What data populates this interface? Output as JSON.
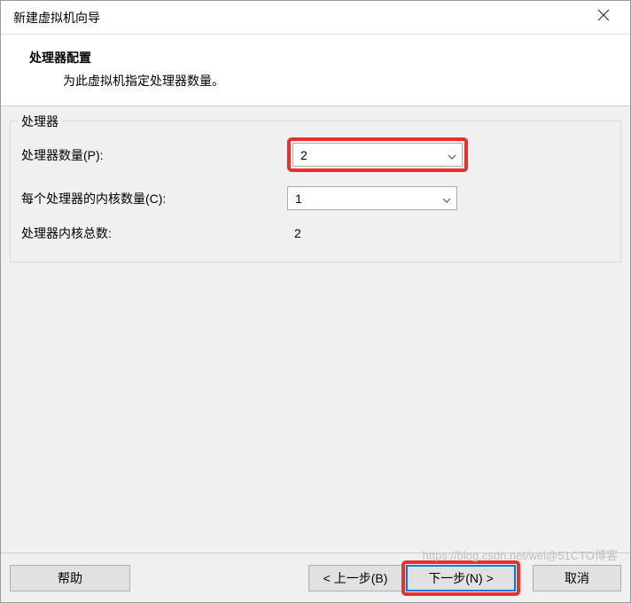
{
  "titlebar": {
    "title": "新建虚拟机向导"
  },
  "header": {
    "title": "处理器配置",
    "subtitle": "为此虚拟机指定处理器数量。"
  },
  "groupbox": {
    "legend": "处理器",
    "rows": {
      "processors": {
        "label": "处理器数量(P):",
        "value": "2"
      },
      "cores": {
        "label": "每个处理器的内核数量(C):",
        "value": "1"
      },
      "total": {
        "label": "处理器内核总数:",
        "value": "2"
      }
    }
  },
  "buttons": {
    "help": "帮助",
    "back": "< 上一步(B)",
    "next": "下一步(N) >",
    "cancel": "取消"
  },
  "watermark": "https://blog.csdn.net/wei@51CTO博客"
}
